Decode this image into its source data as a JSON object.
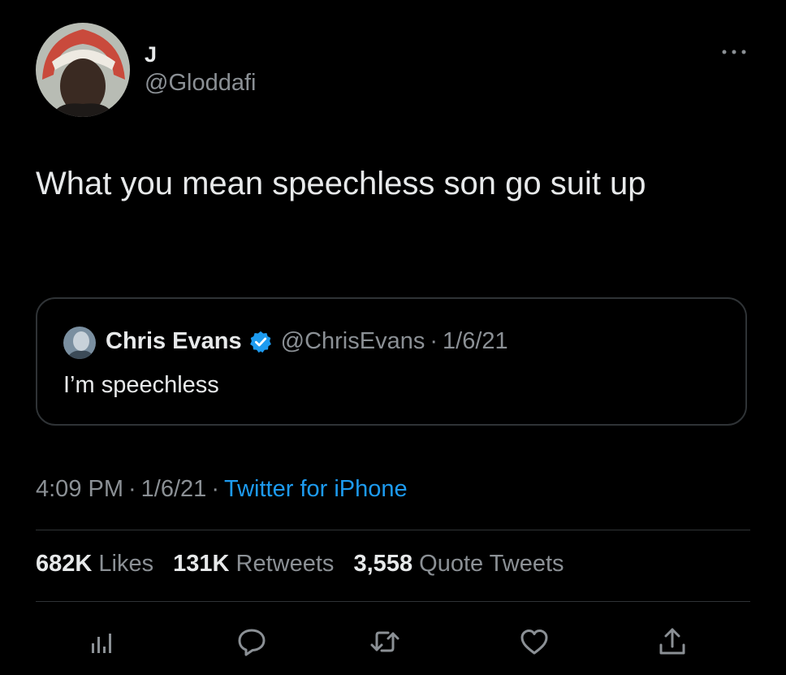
{
  "tweet": {
    "author": {
      "display_name": "J",
      "handle": "@Gloddafi",
      "avatar_icon": "user-avatar"
    },
    "text": "What you mean speechless son go suit up",
    "menu_icon": "more-icon",
    "quoted": {
      "author_name": "Chris Evans",
      "verified_icon": "verified-badge-icon",
      "handle": "@ChrisEvans",
      "separator": "·",
      "date": "1/6/21",
      "text": "I’m speechless"
    },
    "meta": {
      "time": "4:09 PM",
      "separator": "·",
      "date": "1/6/21",
      "source": "Twitter for iPhone"
    },
    "stats": {
      "likes_count": "682K",
      "likes_label": "Likes",
      "retweets_count": "131K",
      "retweets_label": "Retweets",
      "quotes_count": "3,558",
      "quotes_label": "Quote Tweets"
    },
    "actions": [
      "analytics-icon",
      "reply-icon",
      "retweet-icon",
      "like-icon",
      "share-icon"
    ]
  },
  "colors": {
    "background": "#000000",
    "text_primary": "#e7e9ea",
    "text_secondary": "#8b9095",
    "accent": "#1d9bf0",
    "border": "#2f3336"
  }
}
